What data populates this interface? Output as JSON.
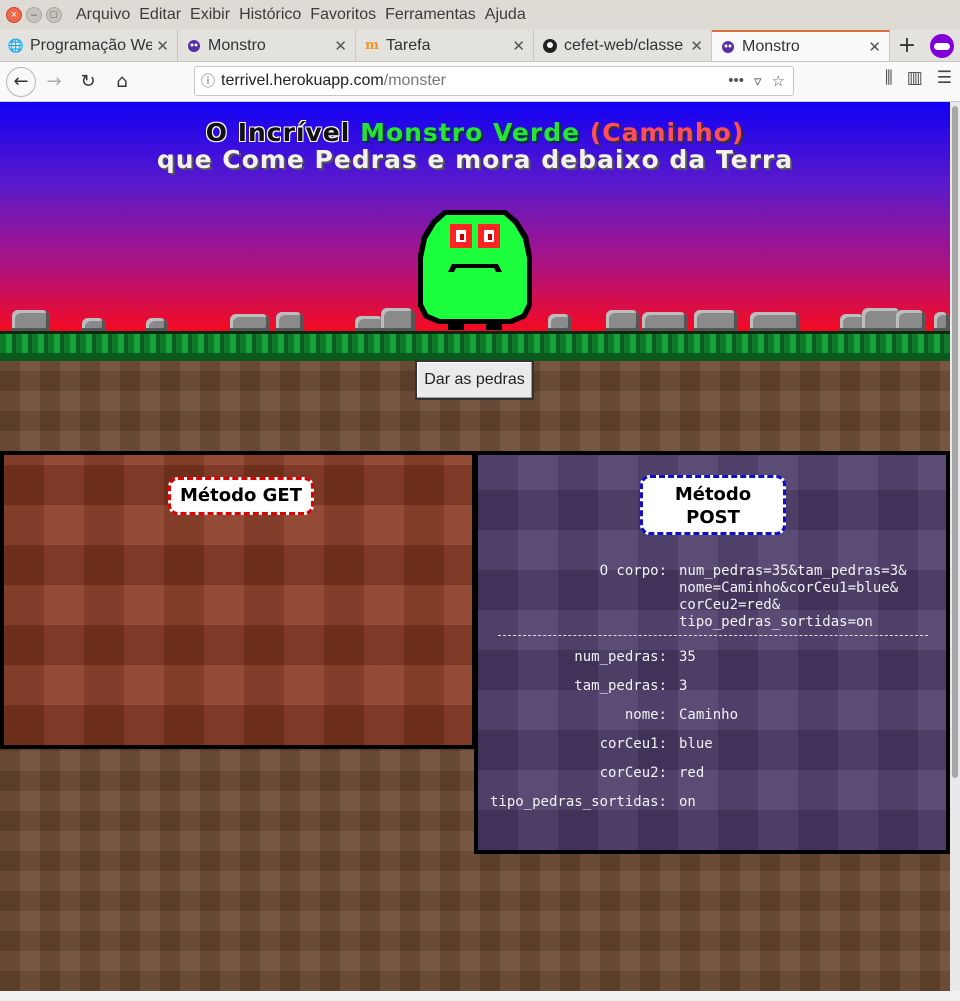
{
  "menubar": {
    "items": [
      "Arquivo",
      "Editar",
      "Exibir",
      "Histórico",
      "Favoritos",
      "Ferramentas",
      "Ajuda"
    ]
  },
  "tabs": [
    {
      "label": "Programação We",
      "icon": "globe-icon"
    },
    {
      "label": "Monstro",
      "icon": "monster-favicon"
    },
    {
      "label": "Tarefa",
      "icon": "moodle-icon"
    },
    {
      "label": "cefet-web/classe",
      "icon": "github-icon"
    },
    {
      "label": "Monstro",
      "icon": "monster-favicon",
      "active": true
    }
  ],
  "url": {
    "host": "terrivel.herokuapp.com",
    "path": "/monster"
  },
  "header": {
    "line1_a": "O Incrível",
    "line1_b": "Monstro Verde",
    "line1_c": "(Caminho)",
    "line2": "que Come Pedras e mora debaixo da Terra"
  },
  "give_button": "Dar as pedras",
  "get_panel": {
    "title": "Método GET"
  },
  "post_panel": {
    "title": "Método POST",
    "body_label": "O corpo:",
    "body_lines": [
      "num_pedras=35&tam_pedras=3&",
      "nome=Caminho&corCeu1=blue&",
      "corCeu2=red&",
      "tipo_pedras_sortidas=on"
    ],
    "params": [
      {
        "key": "num_pedras:",
        "value": "35"
      },
      {
        "key": "tam_pedras:",
        "value": "3"
      },
      {
        "key": "nome:",
        "value": "Caminho"
      },
      {
        "key": "corCeu1:",
        "value": "blue"
      },
      {
        "key": "corCeu2:",
        "value": "red"
      },
      {
        "key": "tipo_pedras_sortidas:",
        "value": "on"
      }
    ]
  },
  "colors": {
    "sky_top": "#1200f2",
    "sky_bottom": "#ff0a14",
    "monster": "#1cff3c",
    "get_border": "#e00000",
    "post_border": "#1010cc"
  }
}
